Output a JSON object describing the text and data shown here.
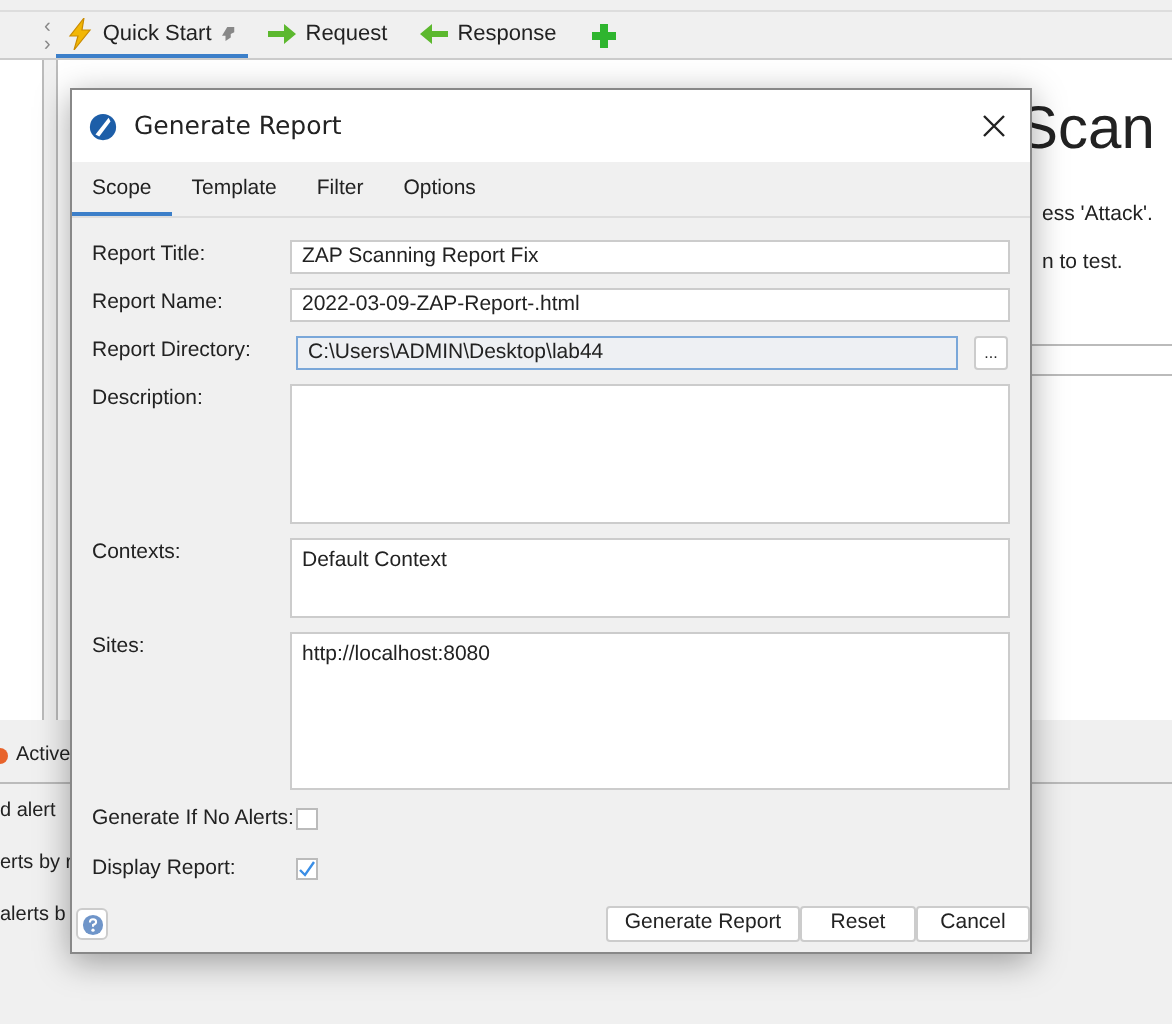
{
  "scroll_arrows": [
    "‹",
    "›"
  ],
  "main_tabs": [
    {
      "label": "Quick Start",
      "kind": "quickstart",
      "selected": true
    },
    {
      "label": "Request",
      "kind": "request",
      "selected": false
    },
    {
      "label": "Response",
      "kind": "response",
      "selected": false
    }
  ],
  "background": {
    "heading": "Scan",
    "lines": [
      "ess 'Attack'.",
      "n to test."
    ],
    "bottom_tab": "Active",
    "bottom_lines": [
      "d alert",
      "erts by r",
      "alerts b"
    ]
  },
  "dialog": {
    "title": "Generate Report",
    "tabs": [
      {
        "label": "Scope",
        "selected": true
      },
      {
        "label": "Template",
        "selected": false
      },
      {
        "label": "Filter",
        "selected": false
      },
      {
        "label": "Options",
        "selected": false
      }
    ],
    "fields": [
      {
        "label": "Report Title:",
        "kind": "text",
        "value": "ZAP Scanning Report Fix"
      },
      {
        "label": "Report Name:",
        "kind": "text",
        "value": "2022-03-09-ZAP-Report-.html"
      },
      {
        "label": "Report Directory:",
        "kind": "directory",
        "value": "C:\\Users\\ADMIN\\Desktop\\lab44",
        "button": "..."
      },
      {
        "label": "Description:",
        "kind": "area"
      },
      {
        "label": "Contexts:",
        "kind": "area",
        "value": "Default Context"
      },
      {
        "label": "Sites:",
        "kind": "area",
        "value": "http://localhost:8080"
      },
      {
        "label": "Generate If No Alerts:",
        "kind": "checkbox",
        "checked": false
      },
      {
        "label": "Display Report:",
        "kind": "checkbox",
        "checked": true
      }
    ],
    "buttons": [
      "Generate Report",
      "Reset",
      "Cancel"
    ]
  }
}
